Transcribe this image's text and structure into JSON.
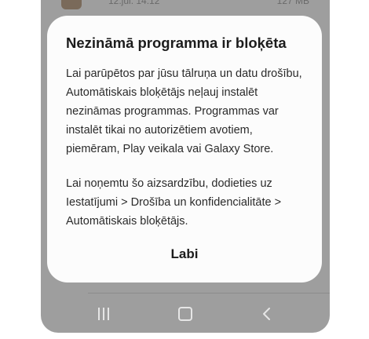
{
  "background_app": {
    "date_text": "12.jūl. 14:12",
    "size_text": "127 MB"
  },
  "dialog": {
    "title": "Nezināmā programma ir bloķēta",
    "paragraph_1": "Lai parūpētos par jūsu tālruņa un datu drošību, Automātiskais bloķētājs neļauj instalēt nezināmas programmas. Programmas var instalēt tikai no autorizētiem avotiem, piemēram, Play veikala vai Galaxy Store.",
    "paragraph_2": "Lai noņemtu šo aizsardzību, dodieties uz Iestatījumi > Drošība un konfidencialitāte > Automātiskais bloķētājs.",
    "ok_label": "Labi"
  },
  "navbar": {
    "icons": [
      "recents-icon",
      "home-icon",
      "back-icon"
    ]
  },
  "colors": {
    "scrim": "#9e9e9e",
    "dialog_bg": "#fcfcfc",
    "text": "#1c1c1c",
    "nav_icon": "#e6e6e6"
  }
}
